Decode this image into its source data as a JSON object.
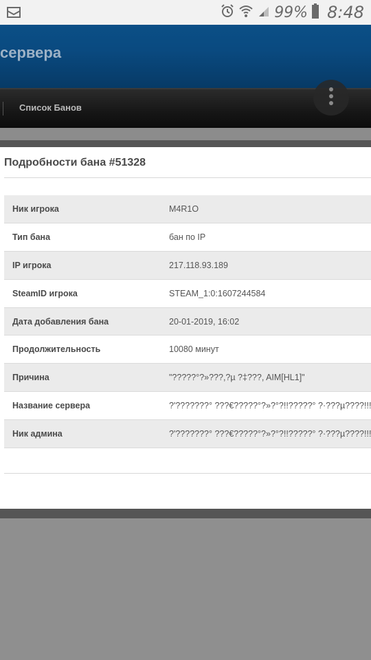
{
  "status_bar": {
    "battery": "99%",
    "time": "8:48"
  },
  "header": {
    "site_title": "сервера"
  },
  "nav": {
    "ban_list_link": "Список Банов"
  },
  "ban_details": {
    "heading": "Подробности бана #51328",
    "rows": [
      {
        "label": "Ник игрока",
        "value": "M4R1O"
      },
      {
        "label": "Тип бана",
        "value": "бан по IP"
      },
      {
        "label": "IP игрока",
        "value": "217.118.93.189"
      },
      {
        "label": "SteamID игрока",
        "value": "STEAM_1:0:1607244584"
      },
      {
        "label": "Дата добавления бана",
        "value": "20-01-2019, 16:02"
      },
      {
        "label": "Продолжительность",
        "value": "10080 минут"
      },
      {
        "label": "Причина",
        "value": "\"?????°?»???,?µ ?‡???, AIM[HL1]\""
      },
      {
        "label": "Название сервера",
        "value": "?'???????° ???€?????°?»?°?!!?????° ?·???µ????!!! (de_"
      },
      {
        "label": "Ник админа",
        "value": "?'???????° ???€?????°?»?°?!!?????° ?·???µ????!!!"
      }
    ]
  }
}
